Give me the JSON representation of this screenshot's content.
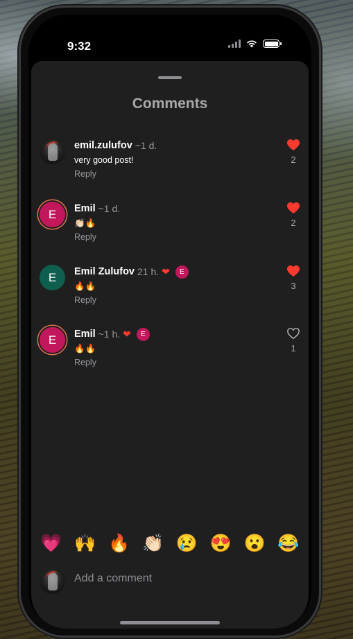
{
  "status_bar": {
    "time": "9:32"
  },
  "sheet": {
    "title": "Comments"
  },
  "comments": [
    {
      "username": "emil.zulufov",
      "time": "~1 d.",
      "text": "very good post!",
      "reply_label": "Reply",
      "likes": "2",
      "liked": true,
      "author_liked": false,
      "avatar_initial": ""
    },
    {
      "username": "Emil",
      "time": "~1 d.",
      "text": "👏🏻🔥",
      "reply_label": "Reply",
      "likes": "2",
      "liked": true,
      "author_liked": false,
      "avatar_initial": "E"
    },
    {
      "username": "Emil Zulufov",
      "time": "21 h.",
      "text": "🔥🔥",
      "reply_label": "Reply",
      "likes": "3",
      "liked": true,
      "author_liked": true,
      "avatar_initial": "E",
      "author_initial": "E"
    },
    {
      "username": "Emil",
      "time": "~1 h.",
      "text": "🔥🔥",
      "reply_label": "Reply",
      "likes": "1",
      "liked": false,
      "author_liked": true,
      "avatar_initial": "E",
      "author_initial": "E"
    }
  ],
  "reactions": [
    "💗",
    "🙌",
    "🔥",
    "👏🏻",
    "😢",
    "😍",
    "😮",
    "😂"
  ],
  "composer": {
    "placeholder": "Add a comment"
  },
  "colors": {
    "like_red": "#ff3b30",
    "pink_avatar": "#c2185b",
    "green_avatar": "#0e5f4e"
  }
}
